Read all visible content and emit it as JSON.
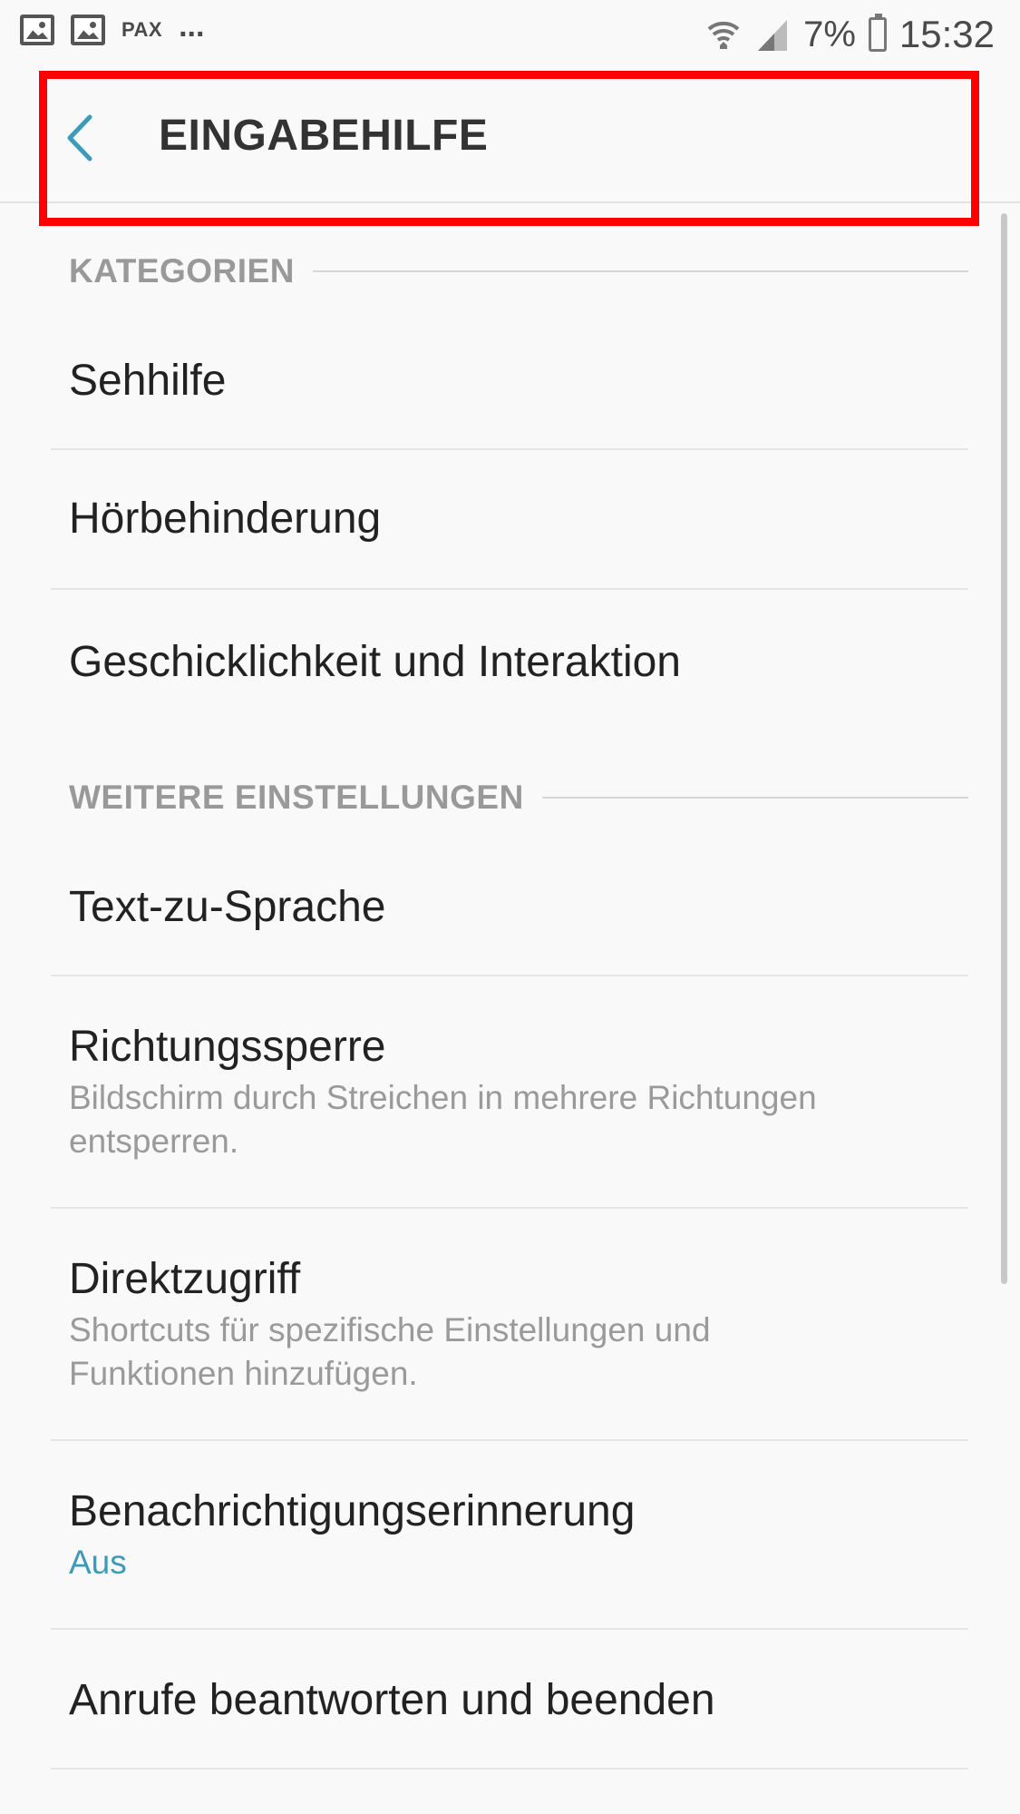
{
  "statusbar": {
    "left_icons": [
      "image-icon",
      "image-icon"
    ],
    "carrier_text": "PAX",
    "overflow_text": "...",
    "battery_text": "7%",
    "clock": "15:32"
  },
  "header": {
    "title": "EINGABEHILFE",
    "back_icon": "chevron-left-icon",
    "accent_color": "#3b9bb8"
  },
  "sections": [
    {
      "label": "KATEGORIEN",
      "items": [
        {
          "title": "Sehhilfe"
        },
        {
          "title": "Hörbehinderung"
        },
        {
          "title": "Geschicklichkeit und Interaktion"
        }
      ]
    },
    {
      "label": "WEITERE EINSTELLUNGEN",
      "items": [
        {
          "title": "Text-zu-Sprache"
        },
        {
          "title": "Richtungssperre",
          "subtitle": "Bildschirm durch Streichen in mehrere Richtungen entsperren."
        },
        {
          "title": "Direktzugriff",
          "subtitle": "Shortcuts für spezifische Einstellungen und Funktionen hinzufügen."
        },
        {
          "title": "Benachrichtigungserinnerung",
          "status": "Aus"
        },
        {
          "title": "Anrufe beantworten und beenden"
        }
      ]
    }
  ],
  "highlight_color": "#ff0000"
}
